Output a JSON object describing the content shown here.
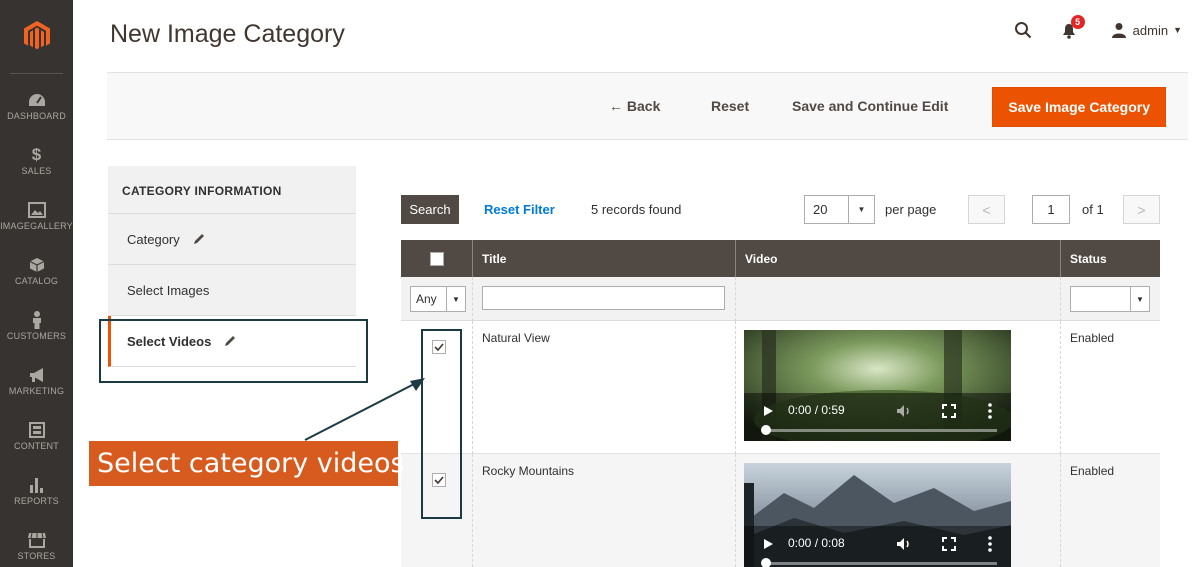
{
  "admin_menu": {
    "items": [
      {
        "label": "DASHBOARD",
        "icon": "dashboard-icon"
      },
      {
        "label": "SALES",
        "icon": "dollar-icon"
      },
      {
        "label": "IMAGEGALLERY",
        "icon": "image-icon"
      },
      {
        "label": "CATALOG",
        "icon": "box-icon"
      },
      {
        "label": "CUSTOMERS",
        "icon": "person-icon"
      },
      {
        "label": "MARKETING",
        "icon": "megaphone-icon"
      },
      {
        "label": "CONTENT",
        "icon": "layout-icon"
      },
      {
        "label": "REPORTS",
        "icon": "bar-chart-icon"
      },
      {
        "label": "STORES",
        "icon": "store-icon"
      }
    ]
  },
  "header": {
    "title": "New Image Category",
    "notifications_count": "5",
    "user": "admin"
  },
  "action_bar": {
    "back": "← Back",
    "reset": "Reset",
    "save_continue": "Save and Continue Edit",
    "save": "Save Image Category"
  },
  "tabs": {
    "title": "CATEGORY INFORMATION",
    "items": [
      {
        "label": "Category",
        "active": false
      },
      {
        "label": "Select Images",
        "active": false
      },
      {
        "label": "Select Videos",
        "active": true
      }
    ]
  },
  "annotation": {
    "text": "Select category videos"
  },
  "grid_toolbar": {
    "search": "Search",
    "reset_filter": "Reset Filter",
    "records": "5 records found",
    "per_page_value": "20",
    "per_page_label": "per page",
    "page": "1",
    "of": "of 1"
  },
  "grid": {
    "columns": [
      "Title",
      "Video",
      "Status"
    ],
    "filter_any": "Any",
    "rows": [
      {
        "checked": true,
        "title": "Natural View",
        "video_time": "0:00 / 0:59",
        "status": "Enabled"
      },
      {
        "checked": true,
        "title": "Rocky Mountains",
        "video_time": "0:00 / 0:08",
        "status": "Enabled"
      }
    ]
  },
  "colors": {
    "accent": "#eb5202",
    "menu_bg": "#373330",
    "grid_header": "#514943",
    "annotation_bg": "#d75a1e",
    "annotation_border": "#1b3a44"
  }
}
